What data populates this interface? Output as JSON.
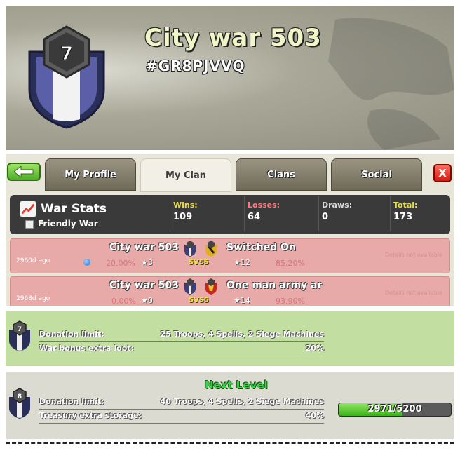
{
  "clan": {
    "name": "City war 503",
    "tag": "#GR8PJVVQ",
    "level": "7"
  },
  "tabs": [
    {
      "label": "My Profile",
      "active": false
    },
    {
      "label": "My Clan",
      "active": true
    },
    {
      "label": "Clans",
      "active": false
    },
    {
      "label": "Social",
      "active": false
    }
  ],
  "close_label": "X",
  "war_stats": {
    "title": "War Stats",
    "friendly_label": "Friendly War",
    "columns": [
      {
        "label": "Wins:",
        "value": "109",
        "color": "#e8dc4a"
      },
      {
        "label": "Losses:",
        "value": "64",
        "color": "#ff7a7a"
      },
      {
        "label": "Draws:",
        "value": "0",
        "color": "#d8d8d8"
      },
      {
        "label": "Total:",
        "value": "173",
        "color": "#e8dc4a"
      }
    ]
  },
  "wars": [
    {
      "ago": "2960d ago",
      "clan": "City war 503",
      "opponent": "Switched On",
      "opponent_level": "9",
      "size": "5VS5",
      "our_percent": "20.00%",
      "our_stars": "3",
      "their_stars": "12",
      "their_percent": "85.20%",
      "details": "Details not available"
    },
    {
      "ago": "2968d ago",
      "clan": "City war 503",
      "opponent": "One man army ar",
      "opponent_level": "10",
      "size": "5VS5",
      "our_percent": "0.00%",
      "our_stars": "0",
      "their_stars": "14",
      "their_percent": "93.90%",
      "details": "Details not available"
    }
  ],
  "current_level": {
    "badge": "7",
    "rows": [
      {
        "label": "Donation limit:",
        "value": "25 Troops, 4 Spells, 2 Siege Machines"
      },
      {
        "label": "War bonus extra loot:",
        "value": "20%"
      }
    ]
  },
  "next_level": {
    "title": "Next Level",
    "badge": "8",
    "rows": [
      {
        "label": "Donation limit:",
        "value": "40 Troops, 4 Spells, 2 Siege Machines"
      },
      {
        "label": "Treasury extra storage:",
        "value": "40%"
      }
    ],
    "xp_current": 2971,
    "xp_max": 5200,
    "xp_text": "2971/5200"
  }
}
